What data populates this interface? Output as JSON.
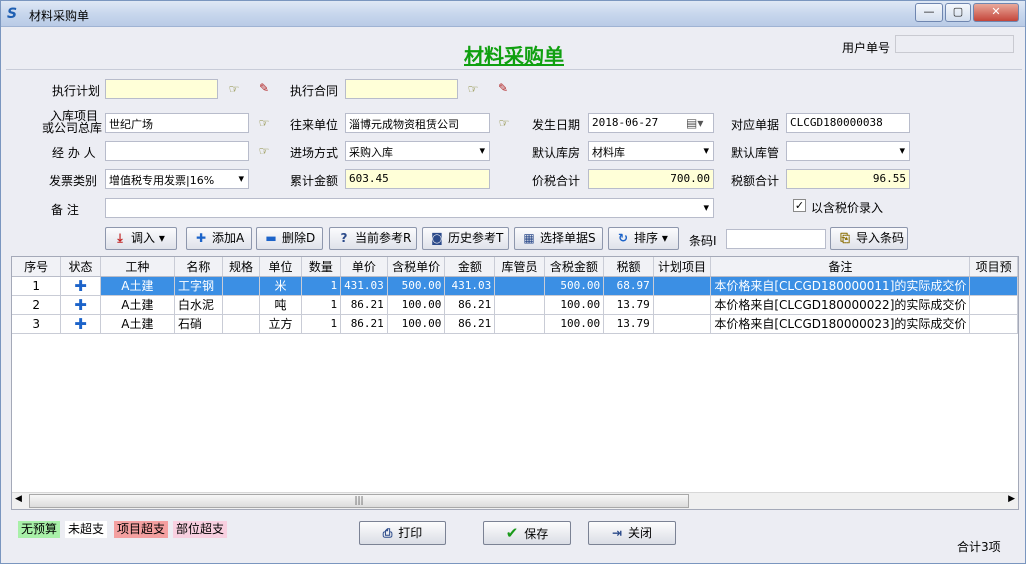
{
  "window": {
    "title": "材料采购单",
    "app_icon": "app-logo-icon",
    "controls": [
      "—",
      "▢",
      "✕"
    ]
  },
  "header": {
    "doc_title": "材料采购单",
    "user_no_label": "用户单号",
    "user_no_value": ""
  },
  "form": {
    "plan_label": "执行计划",
    "plan_value": "",
    "contract_label": "执行合同",
    "contract_value": "",
    "warehouse_project_label_1": "入库项目",
    "warehouse_project_label_2": "或公司总库",
    "warehouse_project_value": "世纪广场",
    "partner_label": "往来单位",
    "partner_value": "淄博元成物资租赁公司",
    "date_label": "发生日期",
    "date_value": "2018-06-27",
    "ref_no_label": "对应单据",
    "ref_no_value": "CLCGD180000038",
    "handler_label": "经  办  人",
    "handler_value": "",
    "entry_mode_label": "进场方式",
    "entry_mode_value": "采购入库",
    "default_store_label": "默认库房",
    "default_store_value": "材料库",
    "default_keeper_label": "默认库管",
    "default_keeper_value": "",
    "invoice_type_label": "发票类别",
    "invoice_type_value": "增值税专用发票|16%",
    "total_amount_label": "累计金额",
    "total_amount_value": "603.45",
    "tax_total_price_label": "价税合计",
    "tax_total_price_value": "700.00",
    "tax_total_label": "税额合计",
    "tax_total_value": "96.55",
    "remark_label": "备      注",
    "remark_value": "",
    "tax_included_label": "以含税价录入",
    "tax_included_checked": true
  },
  "toolbar": {
    "import_label": "调入",
    "add_label": "添加A",
    "delete_label": "删除D",
    "current_ref_label": "当前参考R",
    "history_ref_label": "历史参考T",
    "select_doc_label": "选择单据S",
    "sort_label": "排序",
    "barcode_label": "条码I",
    "barcode_value": "",
    "import_barcode_label": "导入条码"
  },
  "grid": {
    "columns": [
      "序号",
      "状态",
      "工种",
      "名称",
      "规格",
      "单位",
      "数量",
      "单价",
      "含税单价",
      "金额",
      "库管员",
      "含税金额",
      "税额",
      "计划项目",
      "备注",
      "项目预"
    ],
    "rows": [
      {
        "no": "1",
        "status_icon": "plus-icon",
        "trade": "A土建",
        "name": "工字钢",
        "spec": "",
        "unit": "米",
        "qty": "1",
        "price": "431.03",
        "tax_price": "500.00",
        "amount": "431.03",
        "keeper": "",
        "tax_amount": "500.00",
        "tax": "68.97",
        "plan": "",
        "remark": "本价格来自[CLCGD180000011]的实际成交价",
        "budget": ""
      },
      {
        "no": "2",
        "status_icon": "plus-icon",
        "trade": "A土建",
        "name": "白水泥",
        "spec": "",
        "unit": "吨",
        "qty": "1",
        "price": "86.21",
        "tax_price": "100.00",
        "amount": "86.21",
        "keeper": "",
        "tax_amount": "100.00",
        "tax": "13.79",
        "plan": "",
        "remark": "本价格来自[CLCGD180000022]的实际成交价",
        "budget": ""
      },
      {
        "no": "3",
        "status_icon": "plus-icon",
        "trade": "A土建",
        "name": "石硝",
        "spec": "",
        "unit": "立方",
        "qty": "1",
        "price": "86.21",
        "tax_price": "100.00",
        "amount": "86.21",
        "keeper": "",
        "tax_amount": "100.00",
        "tax": "13.79",
        "plan": "",
        "remark": "本价格来自[CLCGD180000023]的实际成交价",
        "budget": ""
      }
    ]
  },
  "legend": [
    {
      "label": "无预算",
      "color": "#a8f0a8"
    },
    {
      "label": "未超支",
      "color": "#ffffff"
    },
    {
      "label": "项目超支",
      "color": "#f4a0a0"
    },
    {
      "label": "部位超支",
      "color": "#f8d0e0"
    }
  ],
  "footer": {
    "print_label": "打印",
    "save_label": "保存",
    "close_label": "关闭",
    "total_label": "合计3项"
  },
  "colors": {
    "title_green": "#10a010",
    "selection_blue": "#3b8fe4",
    "yellow_field": "#ffffd8"
  }
}
